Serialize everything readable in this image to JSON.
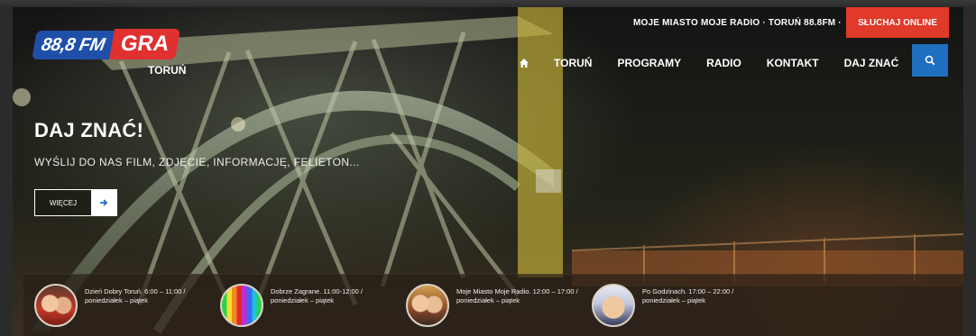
{
  "logo": {
    "fm": "88,8 FM",
    "brand": "GRA",
    "city": "TORUŃ"
  },
  "topbar": {
    "tagline": "MOJE MIASTO MOJE RADIO · TORUŃ 88.8FM ·",
    "listen_label": "SŁUCHAJ ONLINE"
  },
  "nav": {
    "home_icon": "home-icon",
    "items": [
      "TORUŃ",
      "PROGRAMY",
      "RADIO",
      "KONTAKT",
      "DAJ ZNAĆ"
    ],
    "search_icon": "search-icon"
  },
  "hero": {
    "headline": "DAJ ZNAĆ!",
    "subline": "WYŚLIJ DO NAS FILM, ZDJĘCIE, INFORMACJĘ, FELIETON...",
    "more_label": "WIĘCEJ",
    "more_icon": "arrow-right-icon"
  },
  "schedule": [
    {
      "text": "Dzień Dobry Toruń. 6:00 – 11:00 / poniedziałek – piątek"
    },
    {
      "text": "Dobrze Zagrane. 11:00-12:00 / poniedziałek – piątek"
    },
    {
      "text": "Moje Miasto Moje Radio. 12:00 – 17:00 / poniedziałek – piątek"
    },
    {
      "text": "Po Godzinach. 17:00 – 22:00 / poniedziałek – piątek"
    }
  ],
  "colors": {
    "accent_red": "#e03a2a",
    "accent_blue": "#1e6fc0",
    "logo_blue": "#1f4fa8"
  }
}
